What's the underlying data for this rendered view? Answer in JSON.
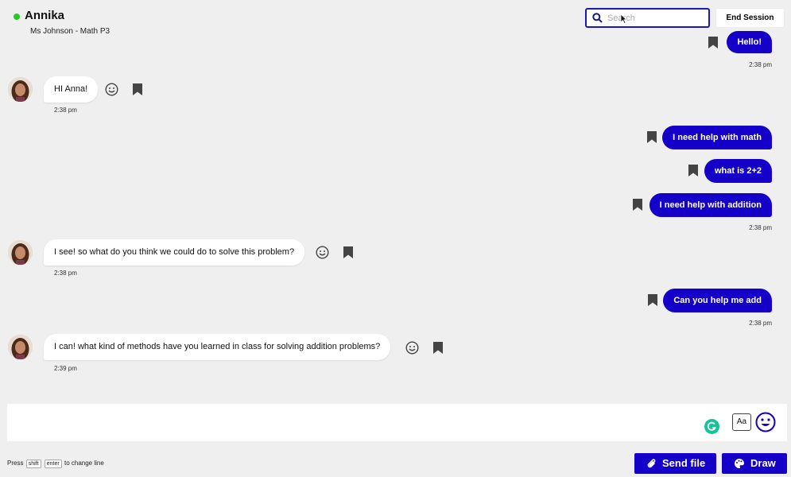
{
  "header": {
    "user_name": "Annika",
    "online_color": "#22cc22",
    "class_label": "Ms Johnson - Math P3",
    "search": {
      "placeholder": "Search",
      "icon": "search-icon"
    },
    "end_session_label": "End Session"
  },
  "messages": [
    {
      "side": "sent",
      "text": "Hello!"
    },
    {
      "time": "2:38 pm"
    },
    {
      "side": "received",
      "text": "HI Anna!",
      "time": "2:38 pm"
    },
    {
      "side": "sent",
      "text": "I need help with math"
    },
    {
      "side": "sent",
      "text": "what is 2+2"
    },
    {
      "side": "sent",
      "text": "I need help with addition",
      "time": "2:38 pm"
    },
    {
      "side": "received",
      "text": "I see! so what do you think we could do to solve this problem?",
      "time": "2:38 pm"
    },
    {
      "side": "sent",
      "text": "Can you help me add",
      "time": "2:38 pm"
    },
    {
      "side": "received",
      "text": "I can! what kind of methods have you learned in class for solving addition problems?",
      "time": "2:39 pm"
    }
  ],
  "composer": {
    "format_label": "Aa",
    "hint_prefix": "Press",
    "hint_key1": "shift",
    "hint_key2": "enter",
    "hint_suffix": "to change line"
  },
  "actions": {
    "send_file_label": "Send file",
    "draw_label": "Draw"
  },
  "colors": {
    "accent": "#1400c8",
    "background": "#efefef"
  }
}
